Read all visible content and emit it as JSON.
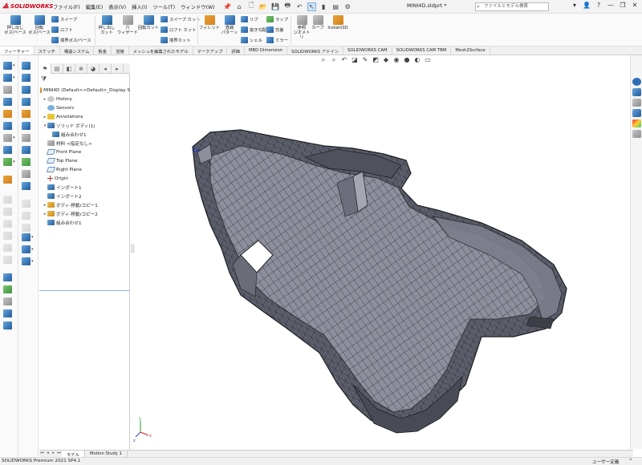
{
  "app": {
    "logo_text": "SOLIDWORKS",
    "document_title": "MINI4D.sldprt *"
  },
  "menu": [
    "ファイル(F)",
    "編集(E)",
    "表示(V)",
    "挿入(I)",
    "ツール(T)",
    "ウィンドウ(W)"
  ],
  "search": {
    "placeholder": "ファイルとモデル検索"
  },
  "ribbon": {
    "extrude_boss": "押し出し\nボス/ベース",
    "revolve_boss": "回転\nボス/ベース",
    "sweep": "スイープ",
    "loft": "ロフト",
    "boundary_boss": "境界ボス/ベース",
    "extrude_cut": "押し出し\nカット",
    "hole_wizard": "穴\nウィザード",
    "revolve_cut": "回転カット",
    "sweep_cut": "スイープ カット",
    "loft_cut": "ロフト カット",
    "boundary_cut": "境界カット",
    "fillet": "フィレット",
    "linear_pattern": "直線\nパターン",
    "rib": "リブ",
    "draft": "抜き勾配",
    "shell": "シェル",
    "wrap": "ラップ",
    "intersect": "交差",
    "mirror": "ミラー",
    "reference_geometry": "参照\nジオメトリ",
    "curves": "カーブ",
    "instant3d": "Instant3D"
  },
  "tabs": [
    "フィーチャー",
    "スケッチ",
    "構造システム",
    "板金",
    "溶接",
    "メッシュを編集されたモデル",
    "マークアップ",
    "評価",
    "MBD Dimension",
    "SOLIDWORKS アドイン",
    "SOLIDWORKS CAM",
    "SOLIDWORKS CAM TBM",
    "Mesh2Surface"
  ],
  "tree": [
    {
      "label": "MINI4D (Default<<Default>_Display S",
      "expander": "",
      "icon": "part"
    },
    {
      "label": "History",
      "expander": "▸",
      "icon": "history"
    },
    {
      "label": "Sensors",
      "expander": "",
      "icon": "sensor"
    },
    {
      "label": "Annotations",
      "expander": "▸",
      "icon": "annotation"
    },
    {
      "label": "ソリッド ボディ(1)",
      "expander": "▾",
      "icon": "solid"
    },
    {
      "label": "組み合わせ1",
      "expander": "",
      "icon": "solid",
      "indent": 1
    },
    {
      "label": "材料 <指定なし>",
      "expander": "",
      "icon": "material"
    },
    {
      "label": "Front Plane",
      "expander": "",
      "icon": "plane"
    },
    {
      "label": "Top Plane",
      "expander": "",
      "icon": "plane"
    },
    {
      "label": "Right Plane",
      "expander": "",
      "icon": "plane"
    },
    {
      "label": "Origin",
      "expander": "",
      "icon": "origin"
    },
    {
      "label": "インポート1",
      "expander": "",
      "icon": "import"
    },
    {
      "label": "インポート2",
      "expander": "",
      "icon": "import"
    },
    {
      "label": "ボディ-移動/コピー1",
      "expander": "▸",
      "icon": "move"
    },
    {
      "label": "ボディ-移動/コピー2",
      "expander": "▸",
      "icon": "move"
    },
    {
      "label": "組み合わせ1",
      "expander": "",
      "icon": "combine"
    }
  ],
  "bottom_tabs": [
    "モデル",
    "Motion Study 1"
  ],
  "status": {
    "left": "SOLIDWORKS Premium 2021 SP4.1",
    "right": "ユーザー定義"
  },
  "colors": {
    "accent": "#3a78b8",
    "model_face": "#60636f",
    "mesh_line": "#24262d",
    "logo_red": "#d0021b"
  }
}
